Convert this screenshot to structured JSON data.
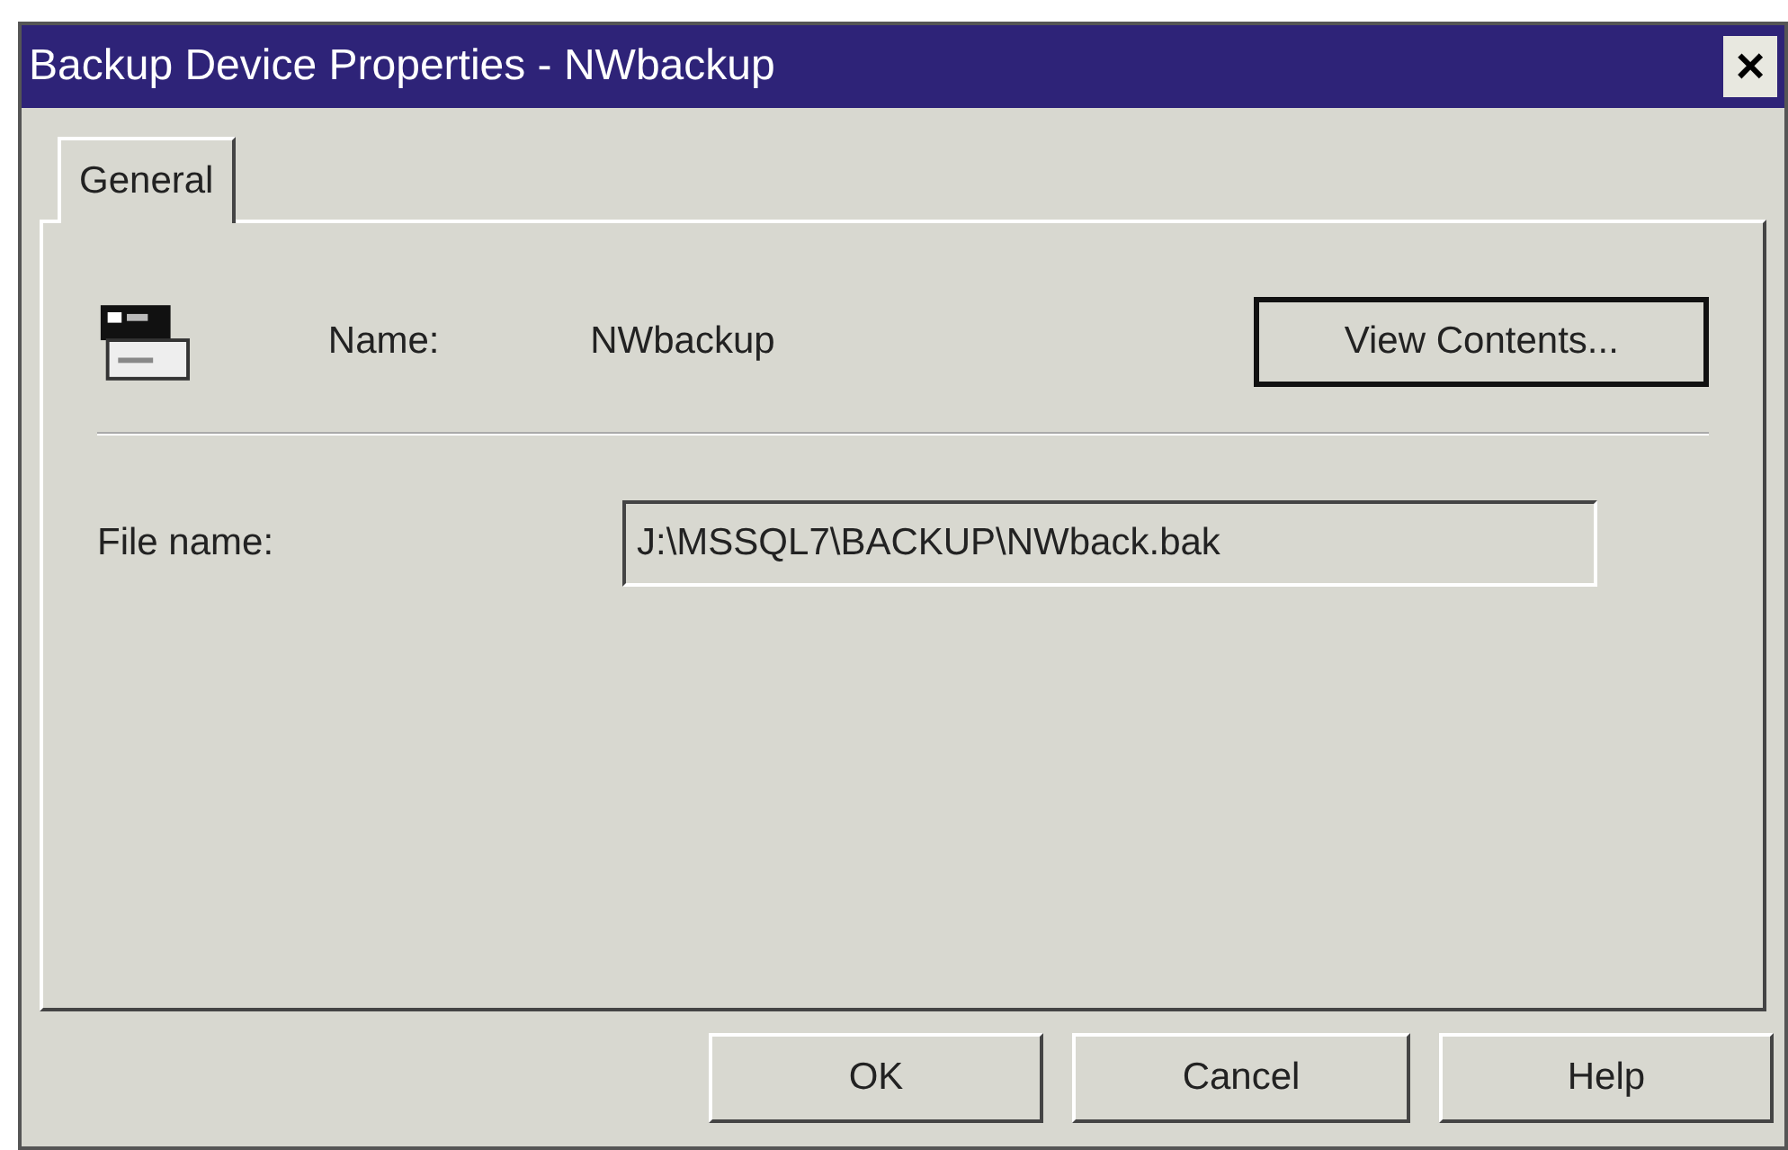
{
  "window": {
    "title": "Backup Device Properties - NWbackup",
    "close": "×"
  },
  "tabs": [
    {
      "label": "General",
      "selected": true
    }
  ],
  "name_row": {
    "label": "Name:",
    "value": "NWbackup",
    "button": {
      "label": "View Contents...",
      "default": true
    }
  },
  "file_name": {
    "label": "File name:",
    "value": "J:\\MSSQL7\\BACKUP\\NWback.bak",
    "read_only": true
  },
  "buttons": [
    {
      "label": "OK",
      "default": false
    },
    {
      "label": "Cancel",
      "default": false
    },
    {
      "label": "Help",
      "default": false
    }
  ]
}
